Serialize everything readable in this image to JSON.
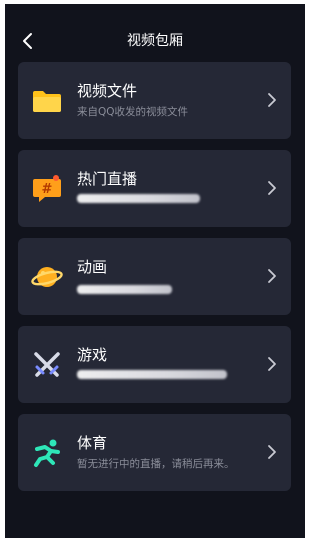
{
  "header": {
    "title": "视频包厢"
  },
  "items": [
    {
      "name": "视频文件",
      "subtitle": "来自QQ收发的视频文件",
      "icon": "folder-icon",
      "accent": "#ffc21a"
    },
    {
      "name": "热门直播",
      "subtitle": "",
      "icon": "live-stream-icon",
      "accent": "#ff9f1a"
    },
    {
      "name": "动画",
      "subtitle": "",
      "icon": "planet-icon",
      "accent": "#ffb020"
    },
    {
      "name": "游戏",
      "subtitle": "",
      "icon": "crossed-swords-icon",
      "accent": "#7a8cff"
    },
    {
      "name": "体育",
      "subtitle": "暂无进行中的直播，请稍后再来。",
      "icon": "running-person-icon",
      "accent": "#2ee6b8"
    }
  ],
  "colors": {
    "background": "#11131c",
    "card": "#252836",
    "text": "#ffffff",
    "subtext": "#8a8d99"
  }
}
